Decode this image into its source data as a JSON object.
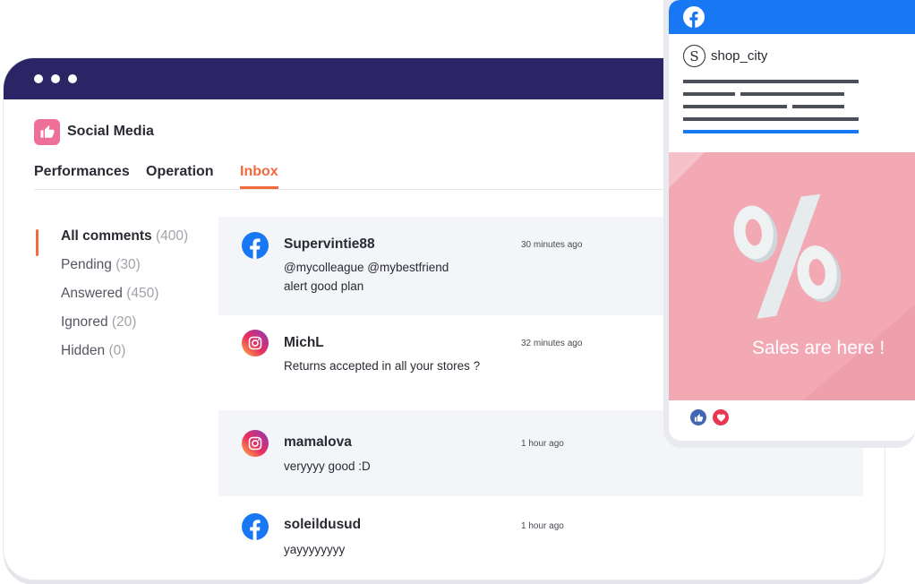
{
  "app": {
    "title": "Social Media"
  },
  "tabs": [
    {
      "label": "Performances"
    },
    {
      "label": "Operation"
    },
    {
      "label": "Inbox",
      "active": true
    }
  ],
  "filters": [
    {
      "label": "All comments",
      "count": "(400)",
      "active": true
    },
    {
      "label": "Pending",
      "count": "(30)"
    },
    {
      "label": "Answered",
      "count": "(450)"
    },
    {
      "label": "Ignored",
      "count": "(20)"
    },
    {
      "label": "Hidden",
      "count": "(0)"
    }
  ],
  "comments": [
    {
      "network": "facebook-icon",
      "author": "Supervintie88",
      "time": "30 minutes ago",
      "lines": [
        "@mycolleague @mybestfriend",
        "alert good plan"
      ]
    },
    {
      "network": "instagram-icon",
      "author": "MichL",
      "time": "32 minutes ago",
      "lines": [
        "Returns accepted in all your stores ?"
      ]
    },
    {
      "network": "instagram-icon",
      "author": "mamalova",
      "time": "1 hour ago",
      "lines": [
        "veryyyy good :D"
      ]
    },
    {
      "network": "facebook-icon",
      "author": "soleildusud",
      "time": "1 hour ago",
      "lines": [
        "yayyyyyyyy"
      ]
    }
  ],
  "post": {
    "network": "facebook-icon",
    "avatar_letter": "S",
    "handle": "shop_city",
    "caption": "Sales are here !",
    "reactions": [
      "like-icon",
      "heart-icon"
    ]
  },
  "colors": {
    "titlebar": "#2b2566",
    "accent": "#f26a3d",
    "facebook": "#1877f2",
    "app_logo": "#ee6f98",
    "post_image": "#f2a9b4"
  }
}
